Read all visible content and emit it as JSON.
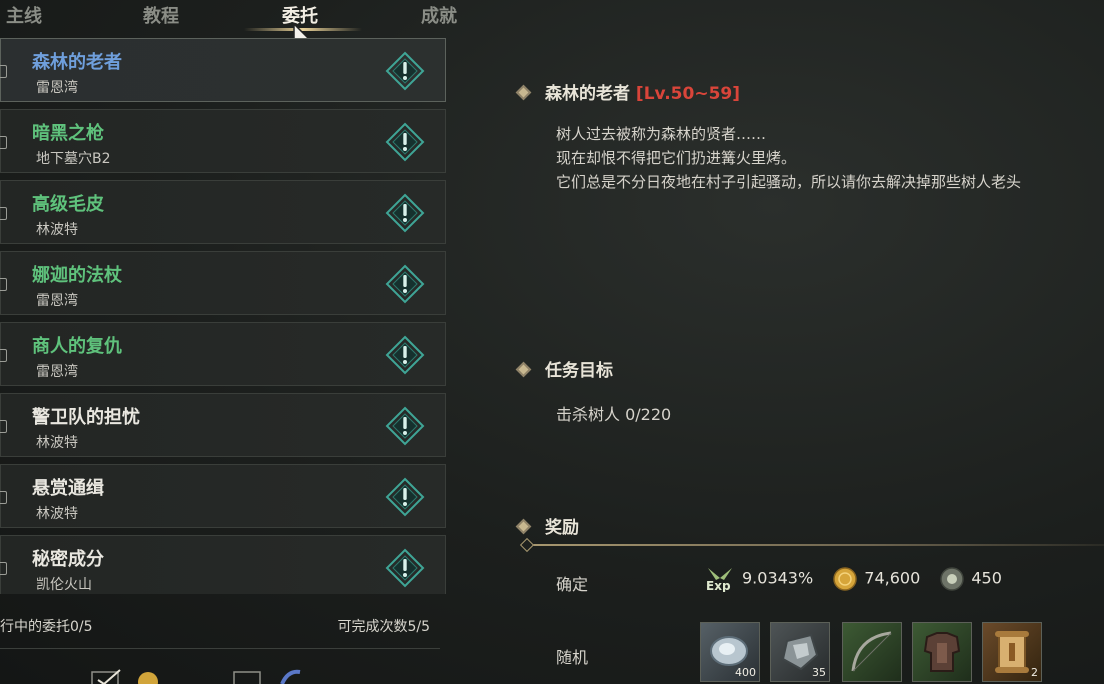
{
  "tabs": [
    {
      "label": "主线"
    },
    {
      "label": "教程"
    },
    {
      "label": "委托"
    },
    {
      "label": "成就"
    }
  ],
  "quests": [
    {
      "title": "森林的老者",
      "location": "雷恩湾",
      "color": "blue"
    },
    {
      "title": "暗黑之枪",
      "location": "地下墓穴B2",
      "color": "green"
    },
    {
      "title": "高级毛皮",
      "location": "林波特",
      "color": "green"
    },
    {
      "title": "娜迦的法杖",
      "location": "雷恩湾",
      "color": "green"
    },
    {
      "title": "商人的复仇",
      "location": "雷恩湾",
      "color": "green"
    },
    {
      "title": "警卫队的担忧",
      "location": "林波特",
      "color": "white"
    },
    {
      "title": "悬赏通缉",
      "location": "林波特",
      "color": "white"
    },
    {
      "title": "秘密成分",
      "location": "凯伦火山",
      "color": "white"
    }
  ],
  "list_footer": {
    "in_progress": "行中的委托0/5",
    "completable": "可完成次数5/5"
  },
  "detail": {
    "quest_name": "森林的老者",
    "level_range": "[Lv.50~59]",
    "description": [
      "树人过去被称为森林的贤者……",
      "现在却恨不得把它们扔进篝火里烤。",
      "它们总是不分日夜地在村子引起骚动，所以请你去解决掉那些树人老头"
    ],
    "objective_header": "任务目标",
    "objective": "击杀树人  0/220",
    "reward_header": "奖励",
    "fixed_label": "确定",
    "exp_value": "9.0343%",
    "gold_value": "74,600",
    "token_value": "450",
    "random_label": "随机",
    "random_items": [
      {
        "icon": "gem-ore-icon",
        "count": "400"
      },
      {
        "icon": "gray-ore-icon",
        "count": "35"
      },
      {
        "icon": "bow-icon",
        "count": ""
      },
      {
        "icon": "armor-icon",
        "count": ""
      },
      {
        "icon": "scroll-icon",
        "count": "2"
      }
    ]
  },
  "colors": {
    "quest_blue": "#6f9fdc",
    "quest_green": "#5fc27c",
    "level_red": "#d9453a",
    "accent_gold": "#c8b890"
  }
}
